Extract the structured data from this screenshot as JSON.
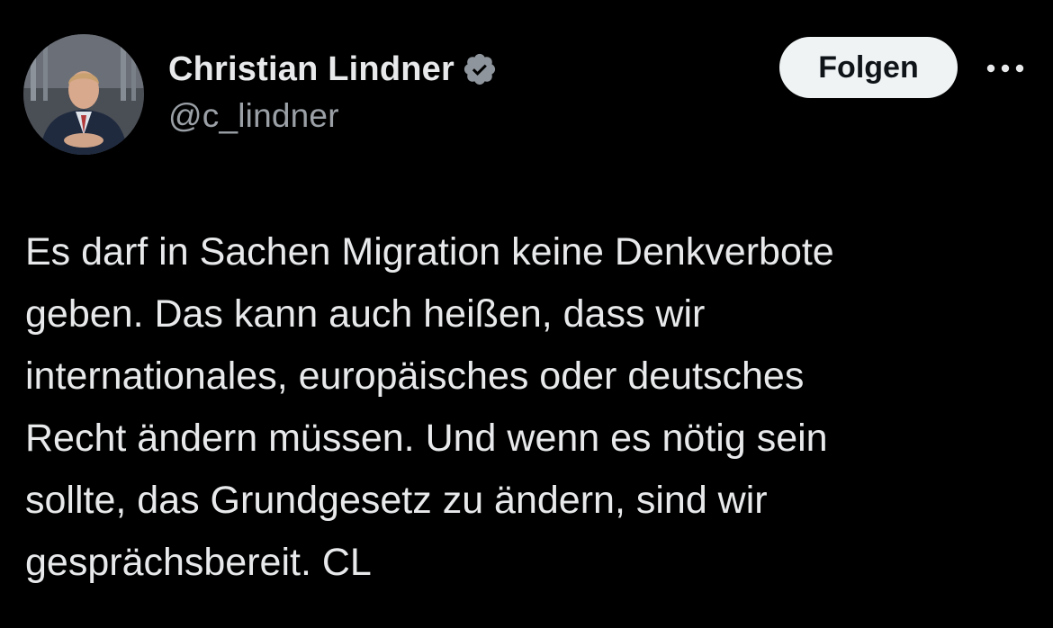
{
  "author": {
    "display_name": "Christian Lindner",
    "handle": "@c_lindner",
    "verified": true,
    "avatar_icon": "profile-photo"
  },
  "actions": {
    "follow_label": "Folgen",
    "more_icon": "more-horizontal-icon"
  },
  "tweet": {
    "lines": [
      "Es darf in Sachen Migration keine Denkverbote",
      "geben. Das kann auch heißen, dass wir",
      "internationales, europäisches oder deutsches",
      "Recht ändern müssen. Und wenn es nötig sein",
      "sollte, das Grundgesetz zu ändern, sind wir",
      "gesprächsbereit. CL"
    ]
  },
  "colors": {
    "background": "#000000",
    "text_primary": "#e7e9ea",
    "text_secondary": "#9aa0a6",
    "button_bg": "#eff3f4",
    "button_text": "#0f1419",
    "badge_bg": "#8e959c"
  }
}
